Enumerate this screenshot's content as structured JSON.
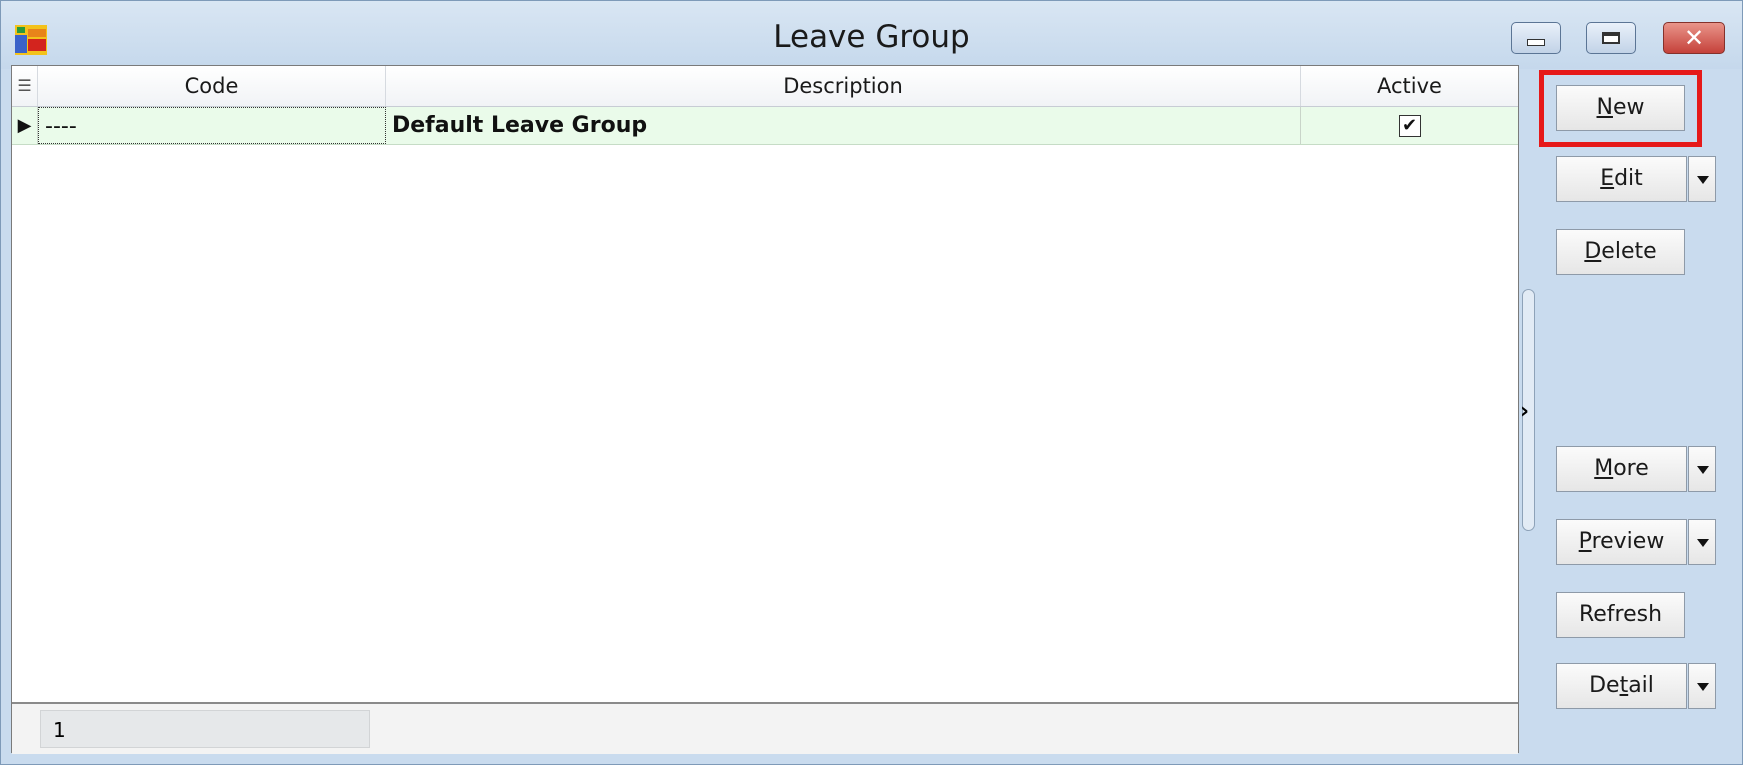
{
  "window": {
    "title": "Leave Group"
  },
  "grid": {
    "columns": [
      "Code",
      "Description",
      "Active"
    ],
    "rows": [
      {
        "code": "----",
        "description": "Default Leave Group",
        "active": true,
        "active_glyph": "✔"
      }
    ],
    "record_count": "1"
  },
  "buttons": {
    "new": {
      "pre": "",
      "key": "N",
      "post": "ew"
    },
    "edit": {
      "pre": "",
      "key": "E",
      "post": "dit"
    },
    "delete": {
      "pre": "",
      "key": "D",
      "post": "elete"
    },
    "more": {
      "pre": "",
      "key": "M",
      "post": "ore"
    },
    "preview": {
      "pre": "",
      "key": "P",
      "post": "review"
    },
    "refresh": {
      "pre": "Refresh",
      "key": "",
      "post": ""
    },
    "detail": {
      "pre": "De",
      "key": "t",
      "post": "ail"
    }
  },
  "highlight_color": "#e61919"
}
